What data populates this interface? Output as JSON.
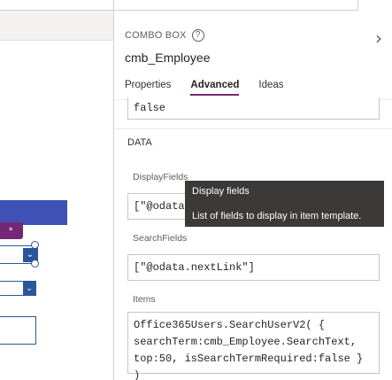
{
  "pane": {
    "control_type": "COMBO BOX",
    "help_icon": "?",
    "control_name": "cmb_Employee",
    "expand_icon": "chevron-right-icon",
    "tabs": [
      {
        "label": "Properties"
      },
      {
        "label": "Advanced"
      },
      {
        "label": "Ideas"
      }
    ],
    "active_tab": "Advanced",
    "accent_color": "#742774"
  },
  "fields": {
    "previous_value": "false",
    "section_title": "DATA",
    "display_fields_label": "DisplayFields",
    "display_fields_value": "[\"@odata",
    "search_fields_label": "SearchFields",
    "search_fields_value": "[\"@odata.nextLink\"]",
    "items_label": "Items",
    "items_value_line1": "Office365Users.SearchUserV2( {",
    "items_value_line2": "searchTerm:cmb_Employee.SearchText,",
    "items_value_line3": "top:50, isSearchTermRequired:false } )"
  },
  "tooltip": {
    "title": "Display fields",
    "body": "List of fields to display in item template."
  },
  "canvas": {
    "header_color": "#3f51b5",
    "selection_color": "#2b579a",
    "chip_icon": "lightbulb-icon"
  }
}
